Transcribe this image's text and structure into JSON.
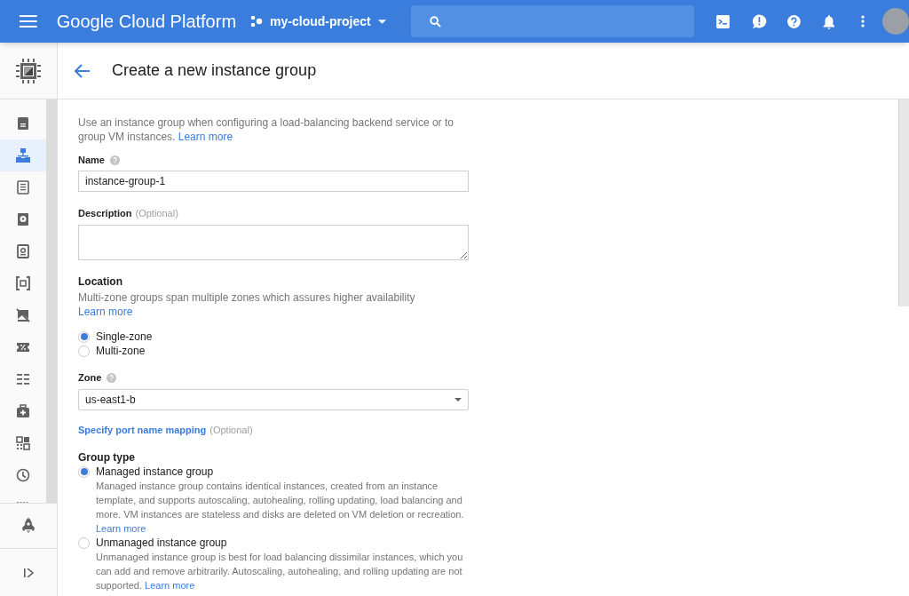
{
  "topbar": {
    "product": "Google Cloud Platform",
    "project": "my-cloud-project"
  },
  "sidebar": {
    "items": [
      {
        "selected": false
      },
      {
        "selected": true
      },
      {
        "selected": false
      },
      {
        "selected": false
      },
      {
        "selected": false
      },
      {
        "selected": false
      },
      {
        "selected": false
      },
      {
        "selected": false
      },
      {
        "selected": false
      },
      {
        "selected": false
      },
      {
        "selected": false
      },
      {
        "selected": false
      },
      {
        "selected": false
      }
    ]
  },
  "page": {
    "title": "Create a new instance group"
  },
  "form": {
    "intro": {
      "text": "Use an instance group when configuring a load-balancing backend service or to group VM instances. ",
      "link": "Learn more"
    },
    "name": {
      "label": "Name",
      "value": "instance-group-1"
    },
    "description": {
      "label": "Description",
      "optional": "(Optional)"
    },
    "location": {
      "label": "Location",
      "help": {
        "text": "Multi-zone groups span multiple zones which assures higher availability ",
        "link": "Learn more"
      },
      "options": [
        {
          "label": "Single-zone",
          "selected": true
        },
        {
          "label": "Multi-zone",
          "selected": false
        }
      ]
    },
    "zone": {
      "label": "Zone",
      "value": "us-east1-b"
    },
    "port_mapping": {
      "link": "Specify port name mapping",
      "optional": "(Optional)"
    },
    "group_type": {
      "label": "Group type",
      "options": [
        {
          "label": "Managed instance group",
          "selected": true,
          "description": "Managed instance group contains identical instances, created from an instance template, and supports autoscaling, autohealing, rolling updating, load balancing and more. VM instances are stateless and disks are deleted on VM deletion or recreation. ",
          "link": "Learn more"
        },
        {
          "label": "Unmanaged instance group",
          "selected": false,
          "description": "Unmanaged instance group is best for load balancing dissimilar instances, which you can add and remove arbitrarily. Autoscaling, autohealing, and rolling updating are not supported. ",
          "link": "Learn more"
        }
      ]
    }
  }
}
